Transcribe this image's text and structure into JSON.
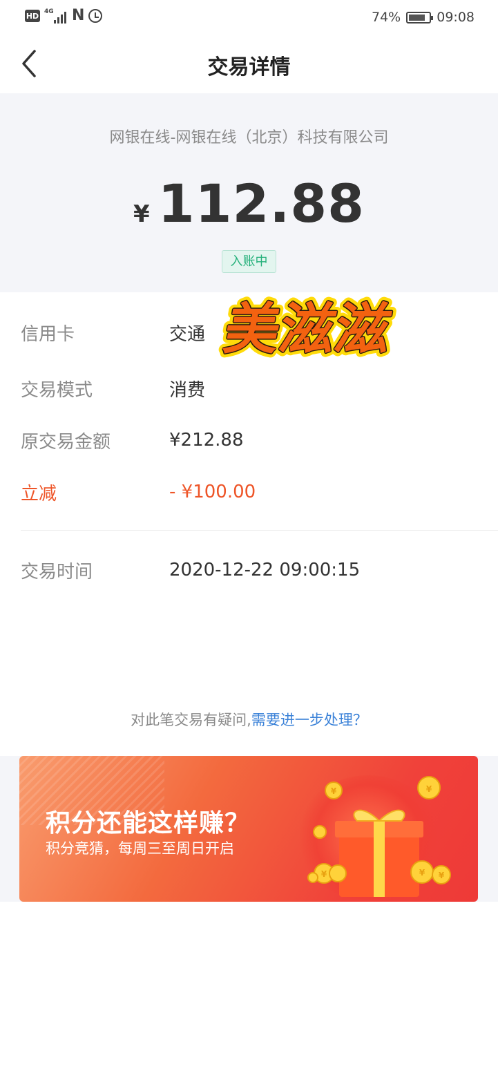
{
  "status_bar": {
    "network": "4G",
    "battery": "74%",
    "time": "09:08"
  },
  "nav": {
    "title": "交易详情"
  },
  "summary": {
    "merchant": "网银在线-网银在线（北京）科技有限公司",
    "currency_symbol": "¥",
    "amount": "112.88",
    "status": "入账中"
  },
  "details": {
    "rows": [
      {
        "label": "信用卡",
        "value": "交通"
      },
      {
        "label": "交易模式",
        "value": "消费"
      },
      {
        "label": "原交易金额",
        "value": "¥212.88"
      },
      {
        "label": "立减",
        "value": "- ¥100.00"
      }
    ],
    "time_row": {
      "label": "交易时间",
      "value": "2020-12-22 09:00:15"
    }
  },
  "sticker": {
    "text": "美滋滋"
  },
  "help": {
    "text": "对此笔交易有疑问,",
    "link": "需要进一步处理？"
  },
  "banner": {
    "title": "积分还能这样赚？",
    "subtitle": "积分竞猜，每周三至周日开启"
  },
  "colors": {
    "accent_red": "#ee5528",
    "status_green": "#24b07a",
    "link_blue": "#3b82d8"
  }
}
